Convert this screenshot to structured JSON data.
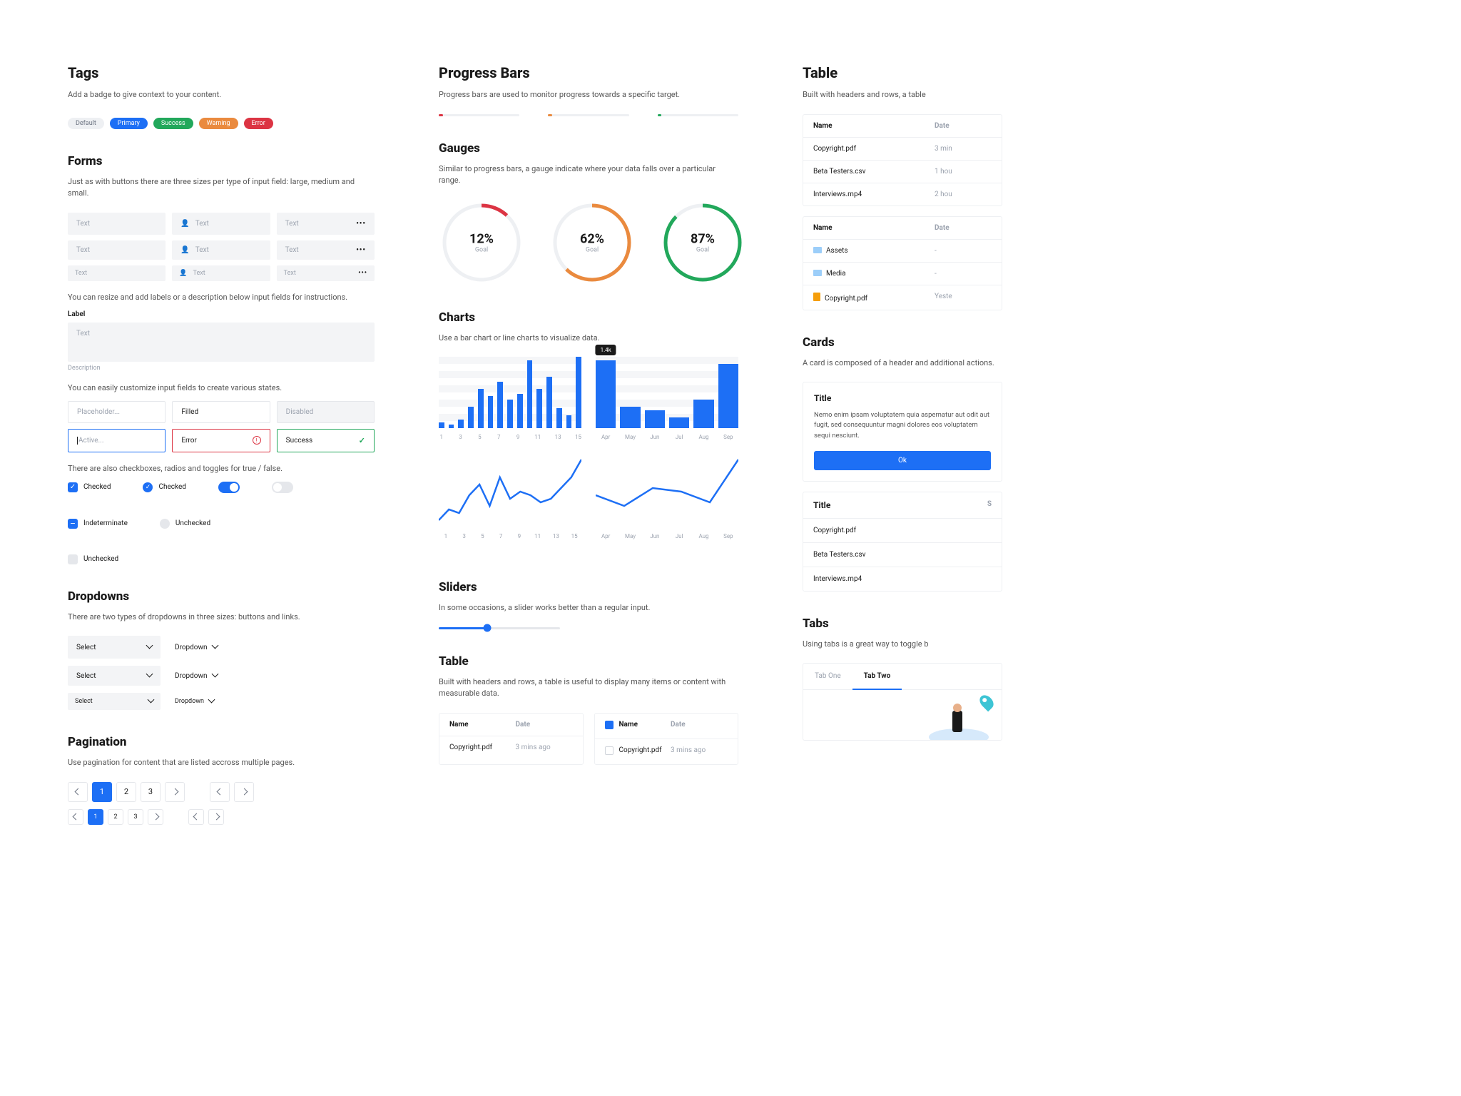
{
  "tags": {
    "title": "Tags",
    "desc": "Add a badge to give context to your content.",
    "items": [
      "Default",
      "Primary",
      "Success",
      "Warning",
      "Error"
    ]
  },
  "forms": {
    "title": "Forms",
    "desc": "Just as with buttons there are three sizes per type of input field: large, medium and small.",
    "placeholder": "Text",
    "help1": "You can resize and add labels or a description below input fields for instructions.",
    "label": "Label",
    "caption": "Description",
    "help2": "You can easily customize input fields to create various states.",
    "states": {
      "placeholder": "Placeholder...",
      "filled": "Filled",
      "disabled": "Disabled",
      "active": "Active...",
      "error": "Error",
      "success": "Success"
    },
    "help3": "There are also checkboxes, radios and toggles for true / false.",
    "checked": "Checked",
    "indeterminate": "Indeterminate",
    "unchecked": "Unchecked"
  },
  "dropdowns": {
    "title": "Dropdowns",
    "desc": "There are two types of dropdowns in three sizes: buttons and links.",
    "select": "Select",
    "link": "Dropdown"
  },
  "pagination": {
    "title": "Pagination",
    "desc": "Use pagination for content that are listed accross multiple pages.",
    "pages": [
      "1",
      "2",
      "3"
    ]
  },
  "progressbars": {
    "title": "Progress Bars",
    "desc": "Progress bars are used to monitor progress towards a specific target."
  },
  "gauges": {
    "title": "Gauges",
    "desc": "Similar to progress bars, a gauge indicate where your data falls over a particular range.",
    "label": "Goal",
    "items": [
      {
        "pct": 12,
        "text": "12%",
        "color": "#dc3443"
      },
      {
        "pct": 62,
        "text": "62%",
        "color": "#ea8a3e"
      },
      {
        "pct": 87,
        "text": "87%",
        "color": "#22a85b"
      }
    ]
  },
  "charts": {
    "title": "Charts",
    "desc": "Use a bar chart or line charts to visualize data.",
    "tooltip": "1.4k"
  },
  "chart_data": [
    {
      "type": "bar",
      "categories": [
        "1",
        "3",
        "5",
        "7",
        "9",
        "11",
        "13",
        "15"
      ],
      "values": [
        8,
        5,
        12,
        30,
        55,
        45,
        65,
        40,
        48,
        95,
        55,
        72,
        28,
        18,
        100
      ],
      "ylim": [
        0,
        100
      ]
    },
    {
      "type": "bar",
      "categories": [
        "Apr",
        "May",
        "Jun",
        "Jul",
        "Aug",
        "Sep"
      ],
      "values": [
        95,
        30,
        25,
        15,
        40,
        90
      ],
      "ylim": [
        0,
        100
      ]
    },
    {
      "type": "line",
      "categories": [
        "1",
        "3",
        "5",
        "7",
        "9",
        "11",
        "13",
        "15"
      ],
      "values": [
        10,
        25,
        20,
        45,
        60,
        30,
        70,
        40,
        50,
        45,
        35,
        40,
        55,
        70,
        95
      ],
      "ylim": [
        0,
        100
      ]
    },
    {
      "type": "line",
      "categories": [
        "Apr",
        "May",
        "Jun",
        "Jul",
        "Aug",
        "Sep"
      ],
      "values": [
        45,
        30,
        55,
        50,
        35,
        95
      ],
      "ylim": [
        0,
        100
      ]
    }
  ],
  "sliders": {
    "title": "Sliders",
    "desc": "In some occasions, a slider works better than a regular input."
  },
  "table_bottom": {
    "title": "Table",
    "desc": "Built with headers and rows, a table is useful to display many items or content with measurable data.",
    "head": {
      "name": "Name",
      "date": "Date"
    },
    "rows": [
      {
        "name": "Copyright.pdf",
        "date": "3 mins ago"
      }
    ]
  },
  "table_right": {
    "title": "Table",
    "desc": "Built with headers and rows, a table",
    "head": {
      "name": "Name",
      "date": "Date"
    },
    "rows1": [
      {
        "name": "Copyright.pdf",
        "date": "3 min"
      },
      {
        "name": "Beta Testers.csv",
        "date": "1 hou"
      },
      {
        "name": "Interviews.mp4",
        "date": "2 hou"
      }
    ],
    "rows2": [
      {
        "name": "Assets",
        "date": "-",
        "icon": "folder"
      },
      {
        "name": "Media",
        "date": "-",
        "icon": "folder"
      },
      {
        "name": "Copyright.pdf",
        "date": "Yeste",
        "icon": "file"
      }
    ]
  },
  "cards": {
    "title": "Cards",
    "desc": "A card is composed of a header and additional actions.",
    "card1": {
      "title": "Title",
      "body": "Nemo enim ipsam voluptatem quia aspernatur aut odit aut fugit, sed consequuntur magni dolores eos voluptatem sequi nesciunt.",
      "button": "Ok"
    },
    "card2": {
      "title": "Title",
      "search": "S",
      "rows": [
        "Copyright.pdf",
        "Beta Testers.csv",
        "Interviews.mp4"
      ]
    }
  },
  "tabs": {
    "title": "Tabs",
    "desc": "Using tabs is a great way to toggle b",
    "tab1": "Tab One",
    "tab2": "Tab Two"
  }
}
